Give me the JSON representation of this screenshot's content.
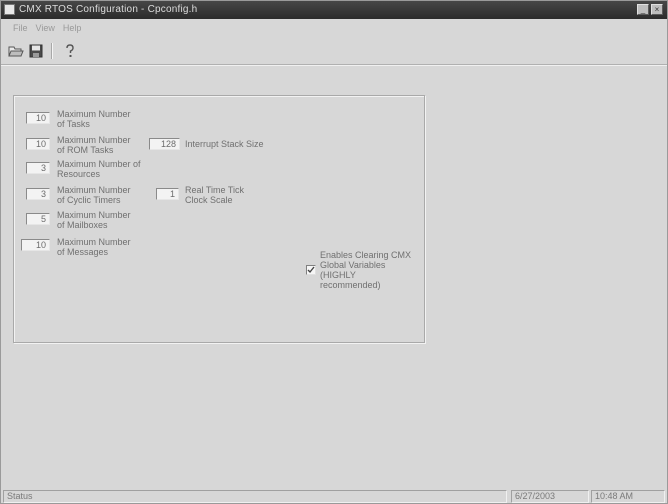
{
  "window": {
    "title": "CMX RTOS Configuration - Cpconfig.h",
    "control_minimize": "_",
    "control_close": "×"
  },
  "menu": {
    "items": [
      "File",
      "View",
      "Help"
    ]
  },
  "toolbar": {
    "icons": [
      "open-folder-icon",
      "save-disk-icon",
      "help-icon"
    ]
  },
  "fields": {
    "max_tasks": {
      "value": "10",
      "label_line1": "Maximum Number",
      "label_line2": "of Tasks"
    },
    "max_rom_tasks": {
      "value": "10",
      "label_line1": "Maximum Number",
      "label_line2": "of ROM Tasks"
    },
    "max_resources": {
      "value": "3",
      "label_line1": "Maximum Number of",
      "label_line2": "Resources"
    },
    "max_cyclic_timers": {
      "value": "3",
      "label_line1": "Maximum Number",
      "label_line2": "of Cyclic Timers"
    },
    "max_mailboxes": {
      "value": "5",
      "label_line1": "Maximum Number",
      "label_line2": "of Mailboxes"
    },
    "max_messages": {
      "value": "10",
      "label_line1": "Maximum Number",
      "label_line2": "of Messages"
    },
    "interrupt_stack_size": {
      "value": "128",
      "label": "Interrupt Stack Size"
    },
    "real_time_tick": {
      "value": "1",
      "label_line1": "Real Time Tick",
      "label_line2": "Clock Scale"
    }
  },
  "checkbox_clear_globals": {
    "checked": true,
    "label_line1": "Enables Clearing CMX",
    "label_line2": "Global Variables",
    "label_line3": "(HIGHLY",
    "label_line4": "recommended)"
  },
  "status": {
    "text": "Status",
    "date": "6/27/2003",
    "time": "10:48 AM"
  }
}
